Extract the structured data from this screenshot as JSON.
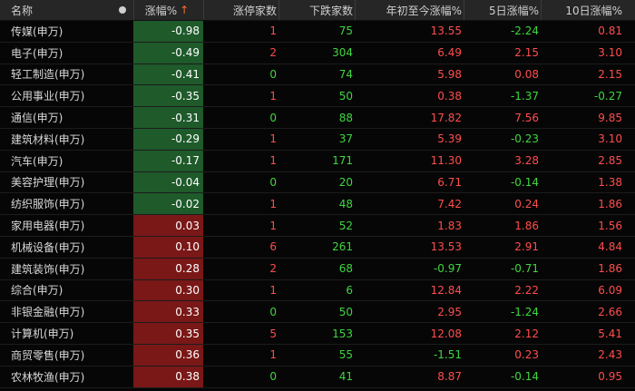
{
  "header": {
    "name": "名称",
    "change": "涨幅%",
    "sort_arrow": "↑",
    "limit_up": "涨停家数",
    "decliners": "下跌家数",
    "ytd": "年初至今涨幅%",
    "d5": "5日涨幅%",
    "d10": "10日涨幅%"
  },
  "colors": {
    "up": "#ff4d4d",
    "down": "#3fd63f",
    "down_bg": "#1e5a2a",
    "up_bg": "#7a1717",
    "sort_arrow": "#ff6a2a"
  },
  "rows": [
    {
      "name": "传媒(申万)",
      "change": "-0.98",
      "limit_up": "1",
      "decliners": "75",
      "ytd": "13.55",
      "d5": "-2.24",
      "d10": "0.81"
    },
    {
      "name": "电子(申万)",
      "change": "-0.49",
      "limit_up": "2",
      "decliners": "304",
      "ytd": "6.49",
      "d5": "2.15",
      "d10": "3.10"
    },
    {
      "name": "轻工制造(申万)",
      "change": "-0.41",
      "limit_up": "0",
      "decliners": "74",
      "ytd": "5.98",
      "d5": "0.08",
      "d10": "2.15"
    },
    {
      "name": "公用事业(申万)",
      "change": "-0.35",
      "limit_up": "1",
      "decliners": "50",
      "ytd": "0.38",
      "d5": "-1.37",
      "d10": "-0.27"
    },
    {
      "name": "通信(申万)",
      "change": "-0.31",
      "limit_up": "0",
      "decliners": "88",
      "ytd": "17.82",
      "d5": "7.56",
      "d10": "9.85"
    },
    {
      "name": "建筑材料(申万)",
      "change": "-0.29",
      "limit_up": "1",
      "decliners": "37",
      "ytd": "5.39",
      "d5": "-0.23",
      "d10": "3.10"
    },
    {
      "name": "汽车(申万)",
      "change": "-0.17",
      "limit_up": "1",
      "decliners": "171",
      "ytd": "11.30",
      "d5": "3.28",
      "d10": "2.85"
    },
    {
      "name": "美容护理(申万)",
      "change": "-0.04",
      "limit_up": "0",
      "decliners": "20",
      "ytd": "6.71",
      "d5": "-0.14",
      "d10": "1.38"
    },
    {
      "name": "纺织服饰(申万)",
      "change": "-0.02",
      "limit_up": "1",
      "decliners": "48",
      "ytd": "7.42",
      "d5": "0.24",
      "d10": "1.86"
    },
    {
      "name": "家用电器(申万)",
      "change": "0.03",
      "limit_up": "1",
      "decliners": "52",
      "ytd": "1.83",
      "d5": "1.86",
      "d10": "1.56"
    },
    {
      "name": "机械设备(申万)",
      "change": "0.10",
      "limit_up": "6",
      "decliners": "261",
      "ytd": "13.53",
      "d5": "2.91",
      "d10": "4.84"
    },
    {
      "name": "建筑装饰(申万)",
      "change": "0.28",
      "limit_up": "2",
      "decliners": "68",
      "ytd": "-0.97",
      "d5": "-0.71",
      "d10": "1.86"
    },
    {
      "name": "综合(申万)",
      "change": "0.30",
      "limit_up": "1",
      "decliners": "6",
      "ytd": "12.84",
      "d5": "2.22",
      "d10": "6.09"
    },
    {
      "name": "非银金融(申万)",
      "change": "0.33",
      "limit_up": "0",
      "decliners": "50",
      "ytd": "2.95",
      "d5": "-1.24",
      "d10": "2.66"
    },
    {
      "name": "计算机(申万)",
      "change": "0.35",
      "limit_up": "5",
      "decliners": "153",
      "ytd": "12.08",
      "d5": "2.12",
      "d10": "5.41"
    },
    {
      "name": "商贸零售(申万)",
      "change": "0.36",
      "limit_up": "1",
      "decliners": "55",
      "ytd": "-1.51",
      "d5": "0.23",
      "d10": "2.43"
    },
    {
      "name": "农林牧渔(申万)",
      "change": "0.38",
      "limit_up": "0",
      "decliners": "41",
      "ytd": "8.87",
      "d5": "-0.14",
      "d10": "0.95"
    }
  ]
}
